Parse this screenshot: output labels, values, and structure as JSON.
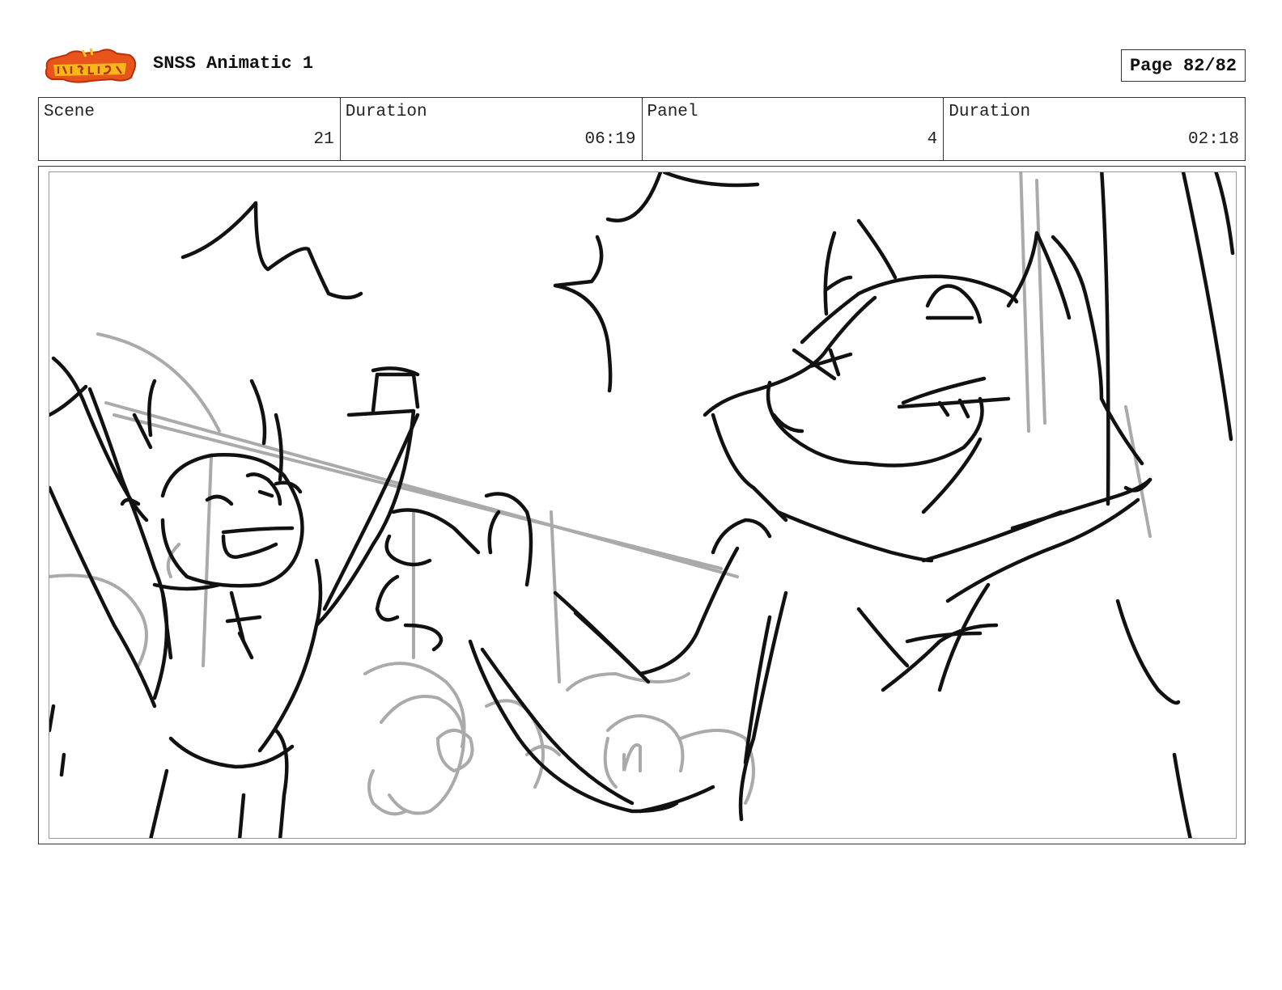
{
  "header": {
    "logo_text": "Sir Noobs-a-Lot",
    "title": "SNSS Animatic 1",
    "page_label": "Page 82/82"
  },
  "info": {
    "scene_label": "Scene",
    "scene_value": "21",
    "scene_duration_label": "Duration",
    "scene_duration_value": "06:19",
    "panel_label": "Panel",
    "panel_value": "4",
    "panel_duration_label": "Duration",
    "panel_duration_value": "02:18"
  },
  "colors": {
    "ink": "#111111",
    "sketch_gray": "#aaaaaa",
    "logo_orange": "#e8541c",
    "logo_yellow": "#f6c21a"
  }
}
